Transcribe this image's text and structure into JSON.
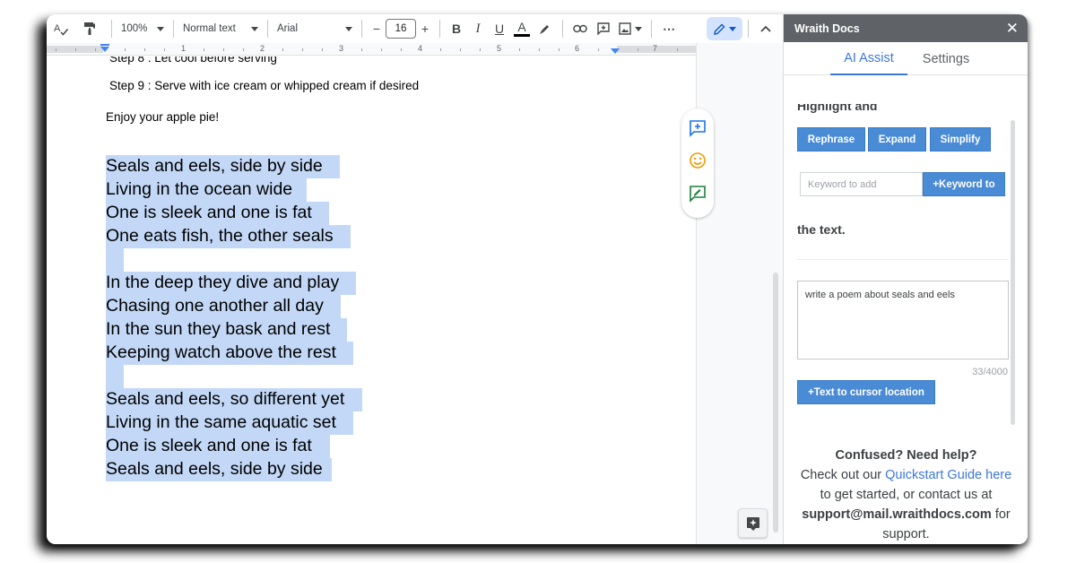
{
  "toolbar": {
    "zoom": "100%",
    "style": "Normal text",
    "font": "Arial",
    "font_size": "16",
    "minus": "−",
    "plus": "+",
    "bold": "B",
    "italic": "I",
    "underline": "U",
    "text_color": "A",
    "more": "⋯"
  },
  "ruler": {
    "numbers": [
      "1",
      "2",
      "3",
      "4",
      "5",
      "6",
      "7"
    ]
  },
  "document": {
    "partial_line": "Step 8 : Let cool before serving",
    "step9": "Step 9 : Serve with ice cream or whipped cream if desired",
    "closing": "Enjoy your apple pie!",
    "poem": [
      "Seals and eels, side by side",
      "Living in the ocean wide",
      "One is sleek and one is fat",
      "One eats fish, the other seals",
      "",
      "In the deep they dive and play",
      "Chasing one another all day",
      "In the sun they bask and rest",
      "Keeping watch above the rest",
      "",
      "Seals and eels, so different yet",
      "Living in the same aquatic set",
      "One is sleek and one is fat",
      "Seals and eels, side by side"
    ]
  },
  "sidebar": {
    "title": "Wraith Docs",
    "close": "✕",
    "tabs": {
      "ai_assist": "AI Assist",
      "settings": "Settings"
    },
    "cut_heading": "Highlight and",
    "buttons": {
      "rephrase": "Rephrase",
      "expand": "Expand",
      "simplify": "Simplify"
    },
    "keyword_placeholder": "Keyword to add",
    "keyword_button": "+Keyword to",
    "the_text": "the text.",
    "prompt_value": "write a poem about seals and eels",
    "counter": "33/4000",
    "insert_button": "+Text to cursor location",
    "help": {
      "heading": "Confused? Need help?",
      "line1_prefix": "Check out our ",
      "link": "Quickstart Guide here",
      "line2": "to get started, or contact us at",
      "email": "support@mail.wraithdocs.com",
      "line3_suffix": " for",
      "line4": "support."
    }
  },
  "colors": {
    "accent": "#3c78d8",
    "button_blue": "#4a8bd6",
    "highlight": "#c3d8f7",
    "header_gray": "#5f6368"
  }
}
